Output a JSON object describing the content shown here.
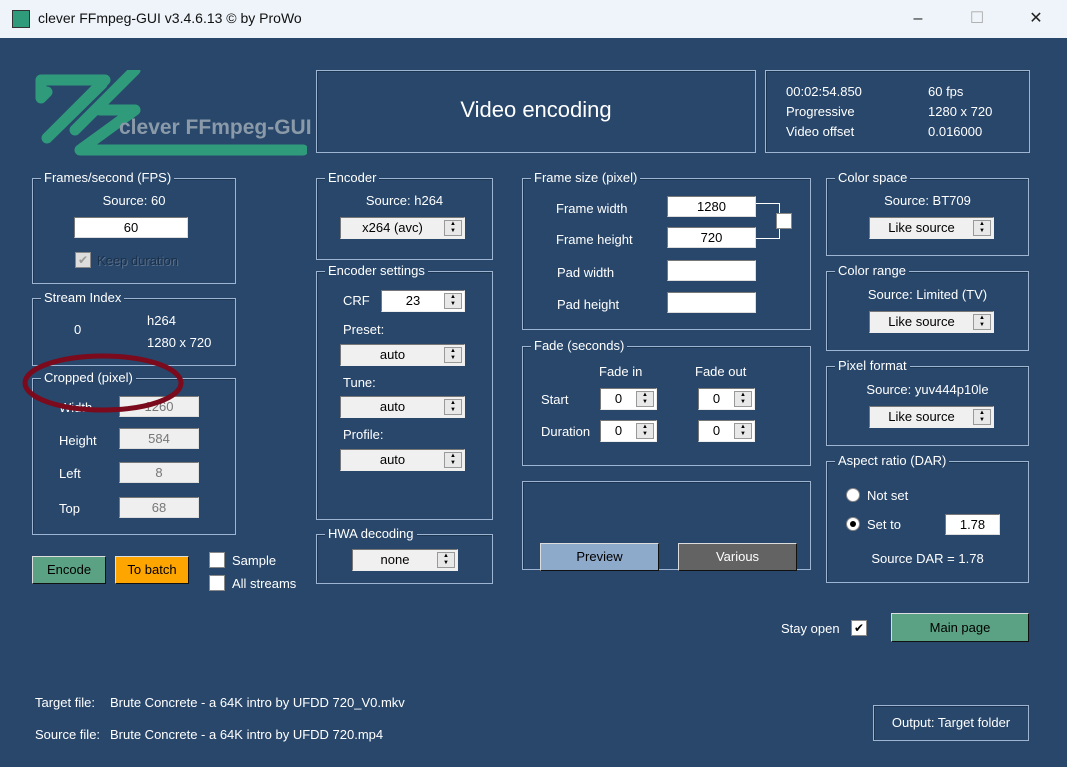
{
  "window": {
    "title": "clever FFmpeg-GUI v3.4.6.13   © by ProWo",
    "minimize": "–",
    "maximize": "☐",
    "close": "✕"
  },
  "logo": {
    "text": "clever FFmpeg-GUI"
  },
  "header": {
    "title": "Video encoding"
  },
  "info": {
    "duration": "00:02:54.850",
    "fps": "60 fps",
    "scan": "Progressive",
    "resolution": "1280 x 720",
    "offset_label": "Video offset",
    "offset": "0.016000"
  },
  "fps": {
    "legend": "Frames/second (FPS)",
    "source": "Source: 60",
    "value": "60",
    "keep_duration": "Keep duration",
    "keep_checked": true
  },
  "stream": {
    "legend": "Stream Index",
    "index": "0",
    "codec": "h264",
    "resolution": "1280 x 720"
  },
  "cropped": {
    "legend": "Cropped (pixel)",
    "fields": [
      {
        "label": "Width",
        "value": "1260"
      },
      {
        "label": "Height",
        "value": "584"
      },
      {
        "label": "Left",
        "value": "8"
      },
      {
        "label": "Top",
        "value": "68"
      }
    ]
  },
  "actions": {
    "encode": "Encode",
    "to_batch": "To batch",
    "sample": "Sample",
    "all_streams": "All streams"
  },
  "encoder": {
    "legend": "Encoder",
    "source": "Source: h264",
    "value": "x264 (avc)"
  },
  "encoder_settings": {
    "legend": "Encoder settings",
    "crf_label": "CRF",
    "crf": "23",
    "preset_label": "Preset:",
    "preset": "auto",
    "tune_label": "Tune:",
    "tune": "auto",
    "profile_label": "Profile:",
    "profile": "auto"
  },
  "hwa": {
    "legend": "HWA decoding",
    "value": "none"
  },
  "frame_size": {
    "legend": "Frame size (pixel)",
    "width_label": "Frame width",
    "width": "1280",
    "height_label": "Frame height",
    "height": "720",
    "pad_width_label": "Pad width",
    "pad_width": "",
    "pad_height_label": "Pad height",
    "pad_height": ""
  },
  "fade": {
    "legend": "Fade (seconds)",
    "fade_in": "Fade in",
    "fade_out": "Fade out",
    "start": "Start",
    "duration": "Duration",
    "start_in": "0",
    "start_out": "0",
    "dur_in": "0",
    "dur_out": "0"
  },
  "preview": {
    "preview": "Preview",
    "various": "Various"
  },
  "color_space": {
    "legend": "Color space",
    "source": "Source: BT709",
    "value": "Like source"
  },
  "color_range": {
    "legend": "Color range",
    "source": "Source: Limited (TV)",
    "value": "Like source"
  },
  "pixel_format": {
    "legend": "Pixel format",
    "source": "Source: yuv444p10le",
    "value": "Like source"
  },
  "aspect": {
    "legend": "Aspect ratio (DAR)",
    "not_set": "Not set",
    "set_to": "Set to",
    "value": "1.78",
    "source_dar": "Source DAR = 1.78"
  },
  "footer": {
    "stay_open": "Stay open",
    "stay_open_checked": true,
    "main_page": "Main page",
    "target_label": "Target file:",
    "target": "Brute Concrete - a 64K intro by UFDD 720_V0.mkv",
    "source_label": "Source file:",
    "source": "Brute Concrete - a 64K intro by UFDD 720.mp4",
    "output": "Output: Target folder"
  },
  "colors": {
    "background": "#28476b",
    "encode": "#5aa283",
    "batch": "#ffa500",
    "preview": "#8eaacb",
    "various": "#636363",
    "logo": "#2f9b7b"
  }
}
